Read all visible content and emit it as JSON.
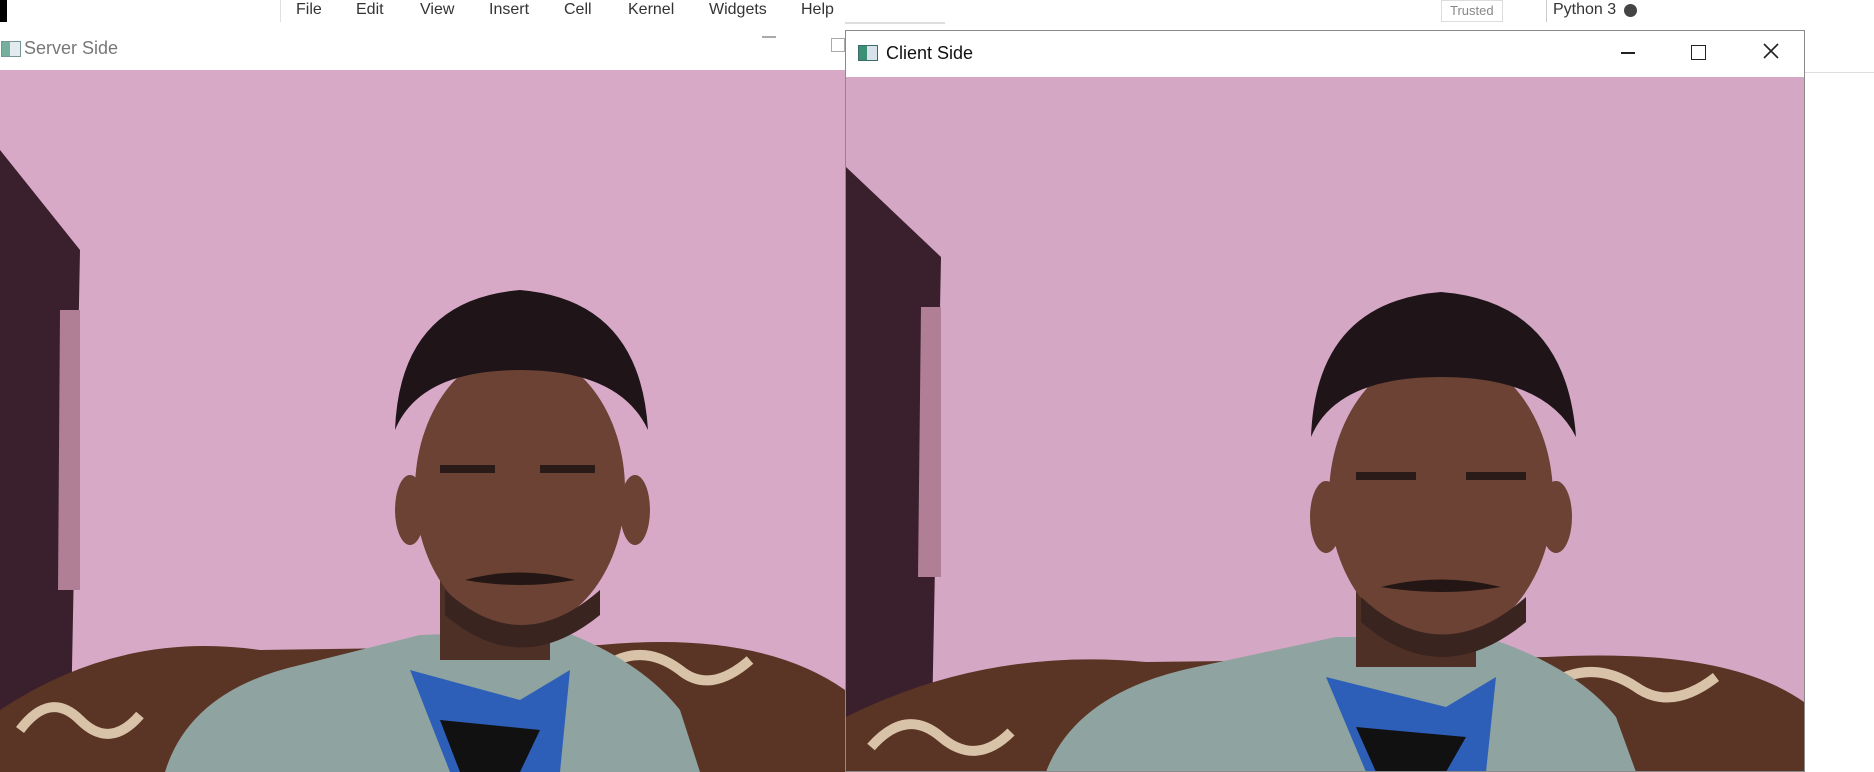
{
  "notebook": {
    "menu": [
      "File",
      "Edit",
      "View",
      "Insert",
      "Cell",
      "Kernel",
      "Widgets",
      "Help"
    ],
    "trusted_label": "Trusted",
    "kernel_label": "Python 3"
  },
  "server_window": {
    "title": "Server Side"
  },
  "client_window": {
    "title": "Client Side"
  },
  "icons": {
    "window_icon": "app-window-icon",
    "minimize": "minimize-icon",
    "maximize": "maximize-icon",
    "close": "close-icon",
    "kernel_status": "kernel-status-dot"
  },
  "colors": {
    "wall": "#d7a9c6",
    "shirt": "#8fa3a0",
    "undershirt": "#2d5fb8",
    "hair": "#1f1418",
    "skin": "#6b4233"
  }
}
